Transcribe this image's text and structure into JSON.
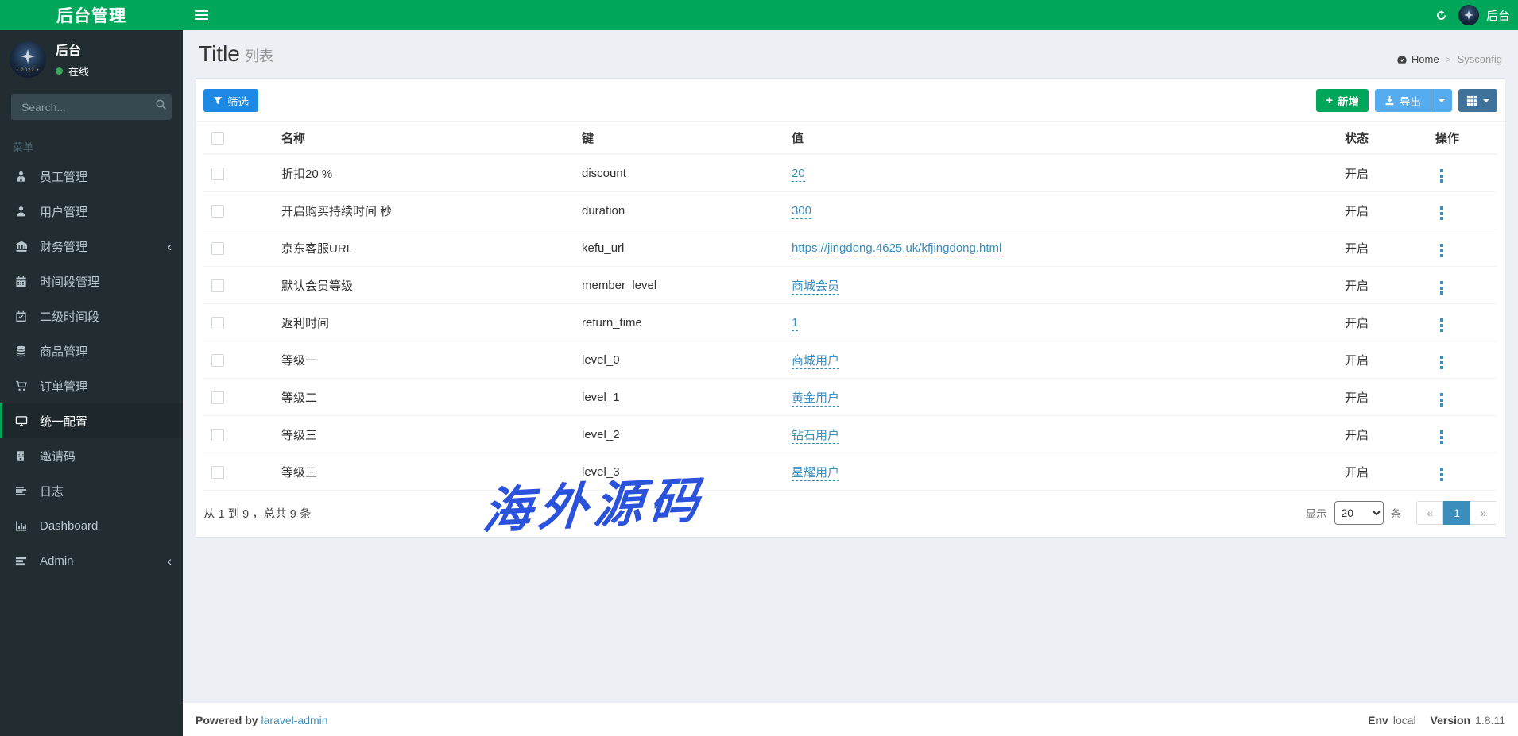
{
  "brand": {
    "title": "后台管理"
  },
  "navbar": {
    "user_label": "后台"
  },
  "sidebar": {
    "user": {
      "name": "后台",
      "status": "在线"
    },
    "search_placeholder": "Search...",
    "menu_header": "菜单",
    "items": [
      {
        "id": "staff",
        "label": "员工管理",
        "icon": "user-tie-icon"
      },
      {
        "id": "users",
        "label": "用户管理",
        "icon": "user-icon"
      },
      {
        "id": "finance",
        "label": "财务管理",
        "icon": "bank-icon",
        "chevron": true
      },
      {
        "id": "timeslot",
        "label": "时间段管理",
        "icon": "calendar-icon"
      },
      {
        "id": "sub-timeslot",
        "label": "二级时间段",
        "icon": "calendar-check-icon"
      },
      {
        "id": "goods",
        "label": "商品管理",
        "icon": "database-icon"
      },
      {
        "id": "orders",
        "label": "订单管理",
        "icon": "cart-icon"
      },
      {
        "id": "sysconfig",
        "label": "统一配置",
        "icon": "desktop-icon",
        "active": true
      },
      {
        "id": "invite-code",
        "label": "邀请码",
        "icon": "building-icon"
      },
      {
        "id": "logs",
        "label": "日志",
        "icon": "list-icon"
      },
      {
        "id": "dashboard",
        "label": "Dashboard",
        "icon": "bar-chart-icon"
      },
      {
        "id": "admin",
        "label": "Admin",
        "icon": "tasks-icon",
        "chevron": true
      }
    ]
  },
  "content_header": {
    "title": "Title",
    "subtitle": "列表"
  },
  "breadcrumb": {
    "home": "Home",
    "current": "Sysconfig"
  },
  "toolbar": {
    "filter": "筛选",
    "new": "新增",
    "export": "导出"
  },
  "table": {
    "columns": [
      "名称",
      "键",
      "值",
      "状态",
      "操作"
    ],
    "rows": [
      {
        "name": "折扣20 %",
        "key": "discount",
        "value": "20",
        "status": "开启"
      },
      {
        "name": "开启购买持续时间 秒",
        "key": "duration",
        "value": "300",
        "status": "开启"
      },
      {
        "name": "京东客服URL",
        "key": "kefu_url",
        "value": "https://jingdong.4625.uk/kfjingdong.html",
        "status": "开启"
      },
      {
        "name": "默认会员等级",
        "key": "member_level",
        "value": "商城会员",
        "status": "开启"
      },
      {
        "name": "返利时间",
        "key": "return_time",
        "value": "1",
        "status": "开启"
      },
      {
        "name": "等级一",
        "key": "level_0",
        "value": "商城用户",
        "status": "开启"
      },
      {
        "name": "等级二",
        "key": "level_1",
        "value": "黄金用户",
        "status": "开启"
      },
      {
        "name": "等级三",
        "key": "level_2",
        "value": "钻石用户",
        "status": "开启"
      },
      {
        "name": "等级三",
        "key": "level_3",
        "value": "星耀用户",
        "status": "开启"
      }
    ]
  },
  "table_footer": {
    "summary": "从 1 到 9 ，总共 9 条",
    "per_page_label_prefix": "显示",
    "per_page": "20",
    "per_page_label_suffix": "条",
    "pager": {
      "prev": "«",
      "page": "1",
      "next": "»"
    }
  },
  "watermark": "海外源码",
  "page_footer": {
    "powered_prefix": "Powered by",
    "powered_link": "laravel-admin",
    "env_label": "Env",
    "env_value": "local",
    "version_label": "Version",
    "version_value": "1.8.11"
  },
  "colors": {
    "accent_green": "#00a65a",
    "sidebar_bg": "#222d32",
    "link_blue": "#3c8dbc",
    "filter_btn": "#1e88e5",
    "export_btn": "#55acee",
    "column_btn": "#3f729b",
    "watermark_blue": "#2b52db",
    "content_bg": "#ecf0f5"
  }
}
